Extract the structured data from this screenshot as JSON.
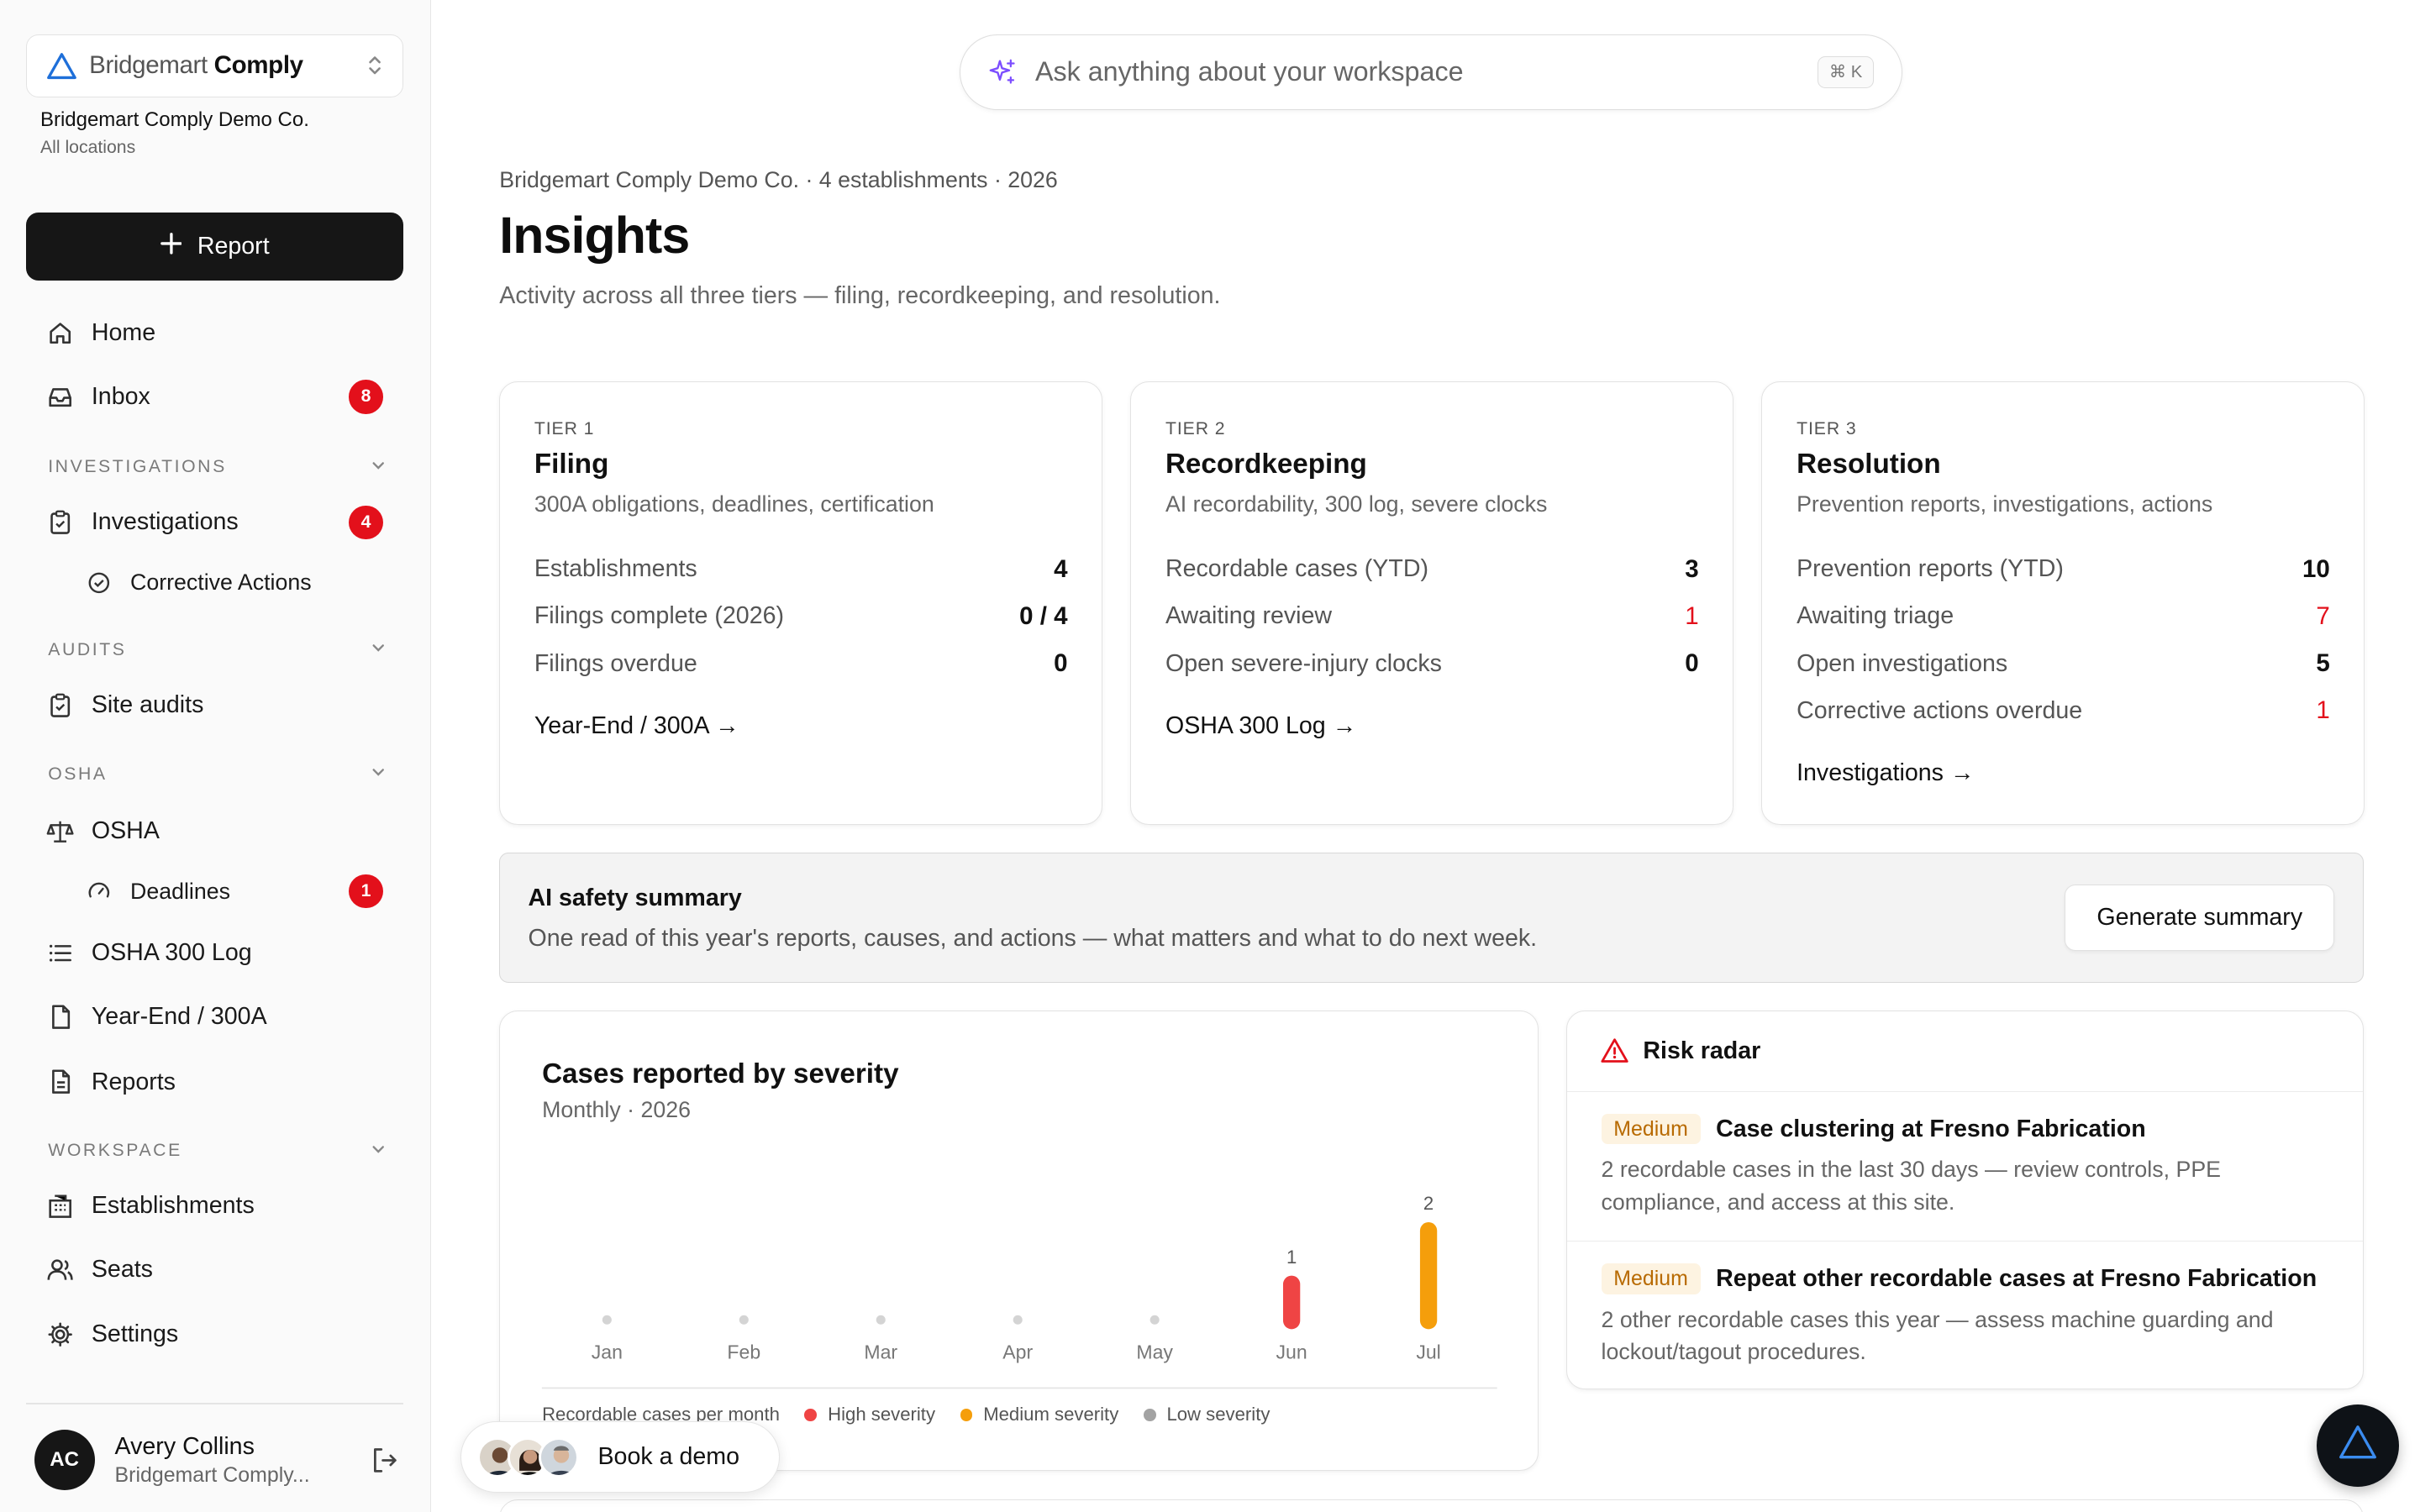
{
  "sidebar": {
    "workspace_name_light": "Bridgemart",
    "workspace_name_dark": "Comply",
    "org_name": "Bridgemart Comply Demo Co.",
    "org_scope": "All locations",
    "report_button": "Report",
    "items": {
      "home": "Home",
      "inbox": "Inbox",
      "inbox_count": "8",
      "investigations_section": "INVESTIGATIONS",
      "investigations": "Investigations",
      "investigations_count": "4",
      "corrective_actions": "Corrective Actions",
      "audits_section": "AUDITS",
      "site_audits": "Site audits",
      "osha_section": "OSHA",
      "osha": "OSHA",
      "deadlines": "Deadlines",
      "deadlines_count": "1",
      "osha_300_log": "OSHA 300 Log",
      "year_end": "Year-End / 300A",
      "reports": "Reports",
      "workspace_section": "WORKSPACE",
      "establishments": "Establishments",
      "seats": "Seats",
      "settings": "Settings"
    },
    "user": {
      "initials": "AC",
      "name": "Avery Collins",
      "org": "Bridgemart Comply..."
    }
  },
  "search": {
    "placeholder": "Ask anything about your workspace",
    "shortcut": "⌘ K"
  },
  "header": {
    "breadcrumb": "Bridgemart Comply Demo Co. · 4 establishments · 2026",
    "title": "Insights",
    "subtitle": "Activity across all three tiers — filing, recordkeeping, and resolution."
  },
  "tiers": [
    {
      "label": "TIER 1",
      "title": "Filing",
      "desc": "300A obligations, deadlines, certification",
      "stats": [
        {
          "label": "Establishments",
          "value": "4"
        },
        {
          "label": "Filings complete (2026)",
          "value": "0 / 4"
        },
        {
          "label": "Filings overdue",
          "value": "0"
        }
      ],
      "link": "Year-End / 300A →"
    },
    {
      "label": "TIER 2",
      "title": "Recordkeeping",
      "desc": "AI recordability, 300 log, severe clocks",
      "stats": [
        {
          "label": "Recordable cases (YTD)",
          "value": "3"
        },
        {
          "label": "Awaiting review",
          "value": "1"
        },
        {
          "label": "Open severe-injury clocks",
          "value": "0"
        }
      ],
      "link": "OSHA 300 Log →"
    },
    {
      "label": "TIER 3",
      "title": "Resolution",
      "desc": "Prevention reports, investigations, actions",
      "stats": [
        {
          "label": "Prevention reports (YTD)",
          "value": "10"
        },
        {
          "label": "Awaiting triage",
          "value": "7"
        },
        {
          "label": "Open investigations",
          "value": "5"
        },
        {
          "label": "Corrective actions overdue",
          "value": "1"
        }
      ],
      "link": "Investigations →"
    }
  ],
  "ai_summary": {
    "title": "AI safety summary",
    "desc": "One read of this year's reports, causes, and actions — what matters and what to do next week.",
    "button": "Generate summary"
  },
  "chart_data": {
    "type": "bar",
    "title": "Cases reported by severity",
    "subtitle": "Monthly · 2026",
    "categories": [
      "Jan",
      "Feb",
      "Mar",
      "Apr",
      "May",
      "Jun",
      "Jul"
    ],
    "series": [
      {
        "name": "High severity",
        "color": "#ef4444",
        "values": [
          0,
          0,
          0,
          0,
          0,
          1,
          0
        ]
      },
      {
        "name": "Medium severity",
        "color": "#f59e0b",
        "values": [
          0,
          0,
          0,
          0,
          0,
          0,
          2
        ]
      },
      {
        "name": "Low severity",
        "color": "#a3a3a3",
        "values": [
          0,
          0,
          0,
          0,
          0,
          0,
          0
        ]
      }
    ],
    "totals": [
      "",
      "",
      "",
      "",
      "",
      "1",
      "2"
    ],
    "legend_caption": "Recordable cases per month",
    "ylim": [
      0,
      2
    ]
  },
  "risk_radar": {
    "title": "Risk radar",
    "items": [
      {
        "level": "Medium",
        "title": "Case clustering at Fresno Fabrication",
        "desc": "2 recordable cases in the last 30 days — review controls, PPE compliance, and access at this site."
      },
      {
        "level": "Medium",
        "title": "Repeat other recordable cases at Fresno Fabrication",
        "desc": "2 other recordable cases this year — assess machine guarding and lockout/tagout procedures."
      }
    ]
  },
  "demo_button": "Book a demo"
}
